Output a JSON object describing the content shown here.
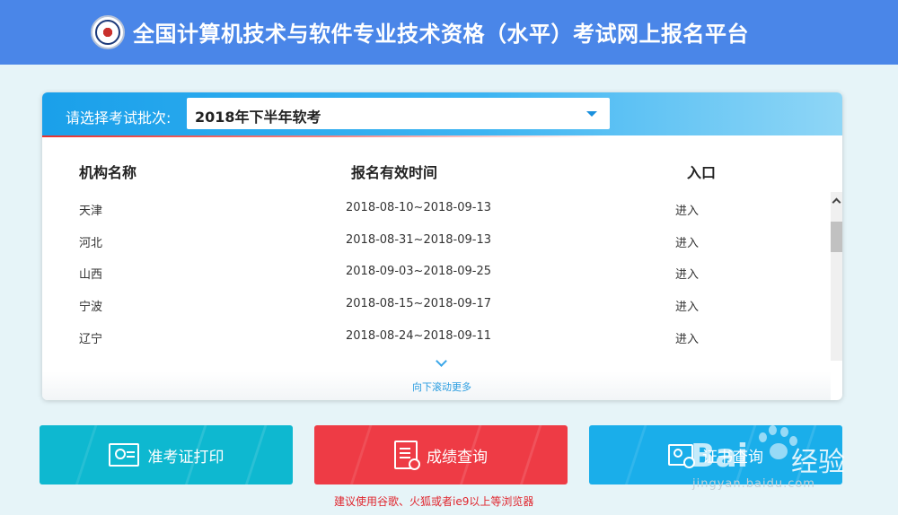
{
  "header": {
    "title": "全国计算机技术与软件专业技术资格（水平）考试网上报名平台",
    "logo": "ruankao-emblem-icon"
  },
  "batch": {
    "label": "请选择考试批次:",
    "selected": "2018年下半年软考"
  },
  "table": {
    "headers": [
      "机构名称",
      "报名有效时间",
      "入口"
    ],
    "rows": [
      {
        "org": "天津",
        "period": "2018-08-10~2018-09-13",
        "action": "进入"
      },
      {
        "org": "河北",
        "period": "2018-08-31~2018-09-13",
        "action": "进入"
      },
      {
        "org": "山西",
        "period": "2018-09-03~2018-09-25",
        "action": "进入"
      },
      {
        "org": "宁波",
        "period": "2018-08-15~2018-09-17",
        "action": "进入"
      },
      {
        "org": "辽宁",
        "period": "2018-08-24~2018-09-11",
        "action": "进入"
      }
    ],
    "scroll_more": "向下滚动更多"
  },
  "actions": {
    "admission": {
      "label": "准考证打印",
      "icon": "id-card-icon",
      "color": "#0eb8d0"
    },
    "score": {
      "label": "成绩查询",
      "icon": "document-search-icon",
      "color": "#ee3b45"
    },
    "certificate": {
      "label": "证书查询",
      "icon": "certificate-search-icon",
      "color": "#1aaeea"
    }
  },
  "notice": "建议使用谷歌、火狐或者ie9以上等浏览器",
  "watermark": {
    "brand": "Bai",
    "brand_suffix": "经验",
    "url": "jingyan.baidu.com"
  }
}
